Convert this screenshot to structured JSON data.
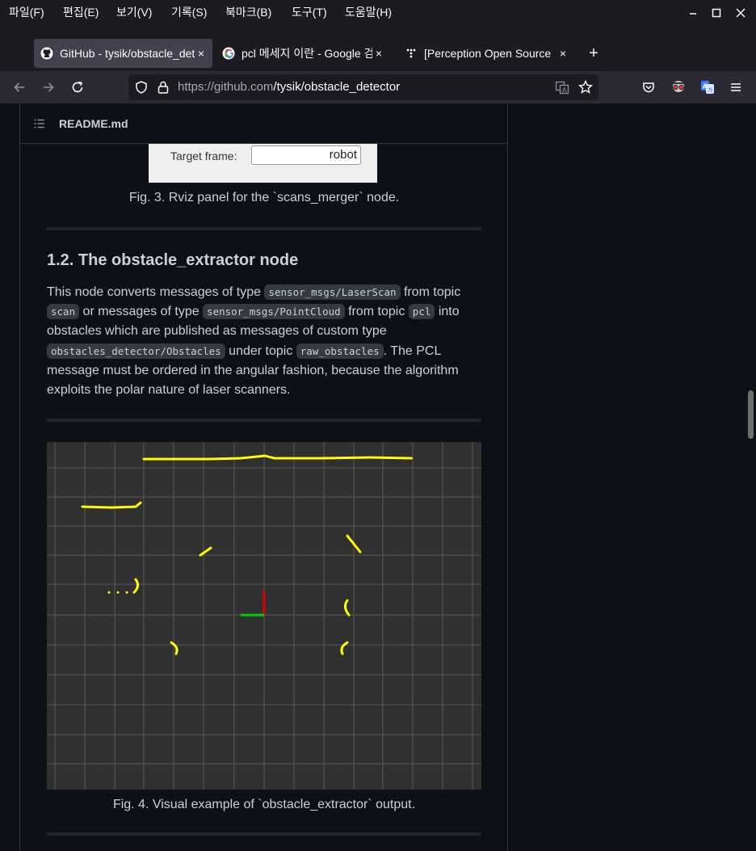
{
  "menu": [
    "파일(F)",
    "편집(E)",
    "보기(V)",
    "기록(S)",
    "북마크(B)",
    "도구(T)",
    "도움말(H)"
  ],
  "tabs": [
    {
      "title": "GitHub - tysik/obstacle_detector",
      "close": "×"
    },
    {
      "title": "pcl 메세지 이란 - Google 검색",
      "close": "×"
    },
    {
      "title": "[Perception Open Source",
      "close": "×"
    }
  ],
  "new_tab": "+",
  "url": {
    "host": "https://github.com",
    "path": "/tysik/obstacle_detector"
  },
  "readme": {
    "title": "README.md"
  },
  "fig3": {
    "label": "Target frame:",
    "value": "robot",
    "caption": "Fig. 3. Rviz panel for the `scans_merger` node."
  },
  "section": {
    "heading": "1.2. The obstacle_extractor node",
    "p": {
      "t1": "This node converts messages of type ",
      "c1": "sensor_msgs/LaserScan",
      "t2": " from topic ",
      "c2": "scan",
      "t3": " or messages of type ",
      "c3": "sensor_msgs/PointCloud",
      "t4": " from topic ",
      "c4": "pcl",
      "t5": " into obstacles which are published as messages of custom type ",
      "c5": "obstacles_detector/Obstacles",
      "t6": " under topic ",
      "c6": "raw_obstacles",
      "t7": ". The PCL message must be ordered in the angular fashion, because the algorithm exploits the polar nature of laser scanners."
    }
  },
  "fig4": {
    "caption": "Fig. 4. Visual example of `obstacle_extractor` output."
  },
  "colors": {
    "accent_yellow": "#ffff00",
    "axis_red": "#ff0000",
    "axis_green": "#00ff00",
    "grid": "#5a5a5a"
  }
}
